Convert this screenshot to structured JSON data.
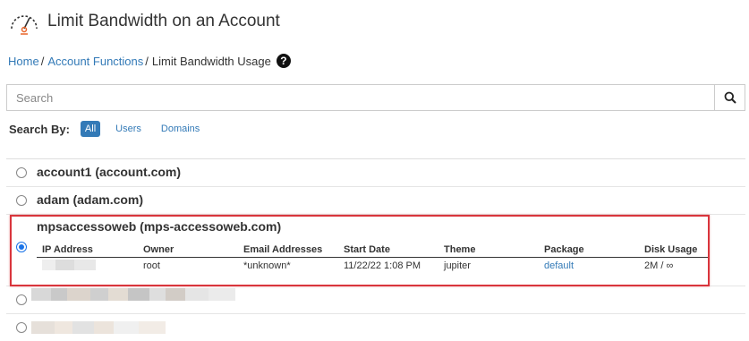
{
  "header": {
    "title": "Limit Bandwidth on an Account",
    "icon": "speedometer-icon"
  },
  "breadcrumb": {
    "items": [
      "Home",
      "Account Functions"
    ],
    "separator": "/",
    "current": "Limit Bandwidth Usage",
    "help": "?"
  },
  "search": {
    "placeholder": "Search",
    "value": ""
  },
  "search_by": {
    "label": "Search By:",
    "options": [
      "All",
      "Users",
      "Domains"
    ],
    "selected": "All"
  },
  "accounts": [
    {
      "label": "account1 (account.com)",
      "selected": false
    },
    {
      "label": "adam (adam.com)",
      "selected": false
    },
    {
      "label": "mpsaccessoweb (mps-accessoweb.com)",
      "selected": true,
      "details": {
        "headers": [
          "IP Address",
          "Owner",
          "Email Addresses",
          "Start Date",
          "Theme",
          "Package",
          "Disk Usage"
        ],
        "values": [
          "",
          "root",
          "*unknown*",
          "11/22/22 1:08 PM",
          "jupiter",
          "default",
          "2M / ∞"
        ]
      }
    }
  ],
  "colors": {
    "link": "#337ab7",
    "highlight_border": "#d9353c",
    "radio_selected": "#1a73e8"
  }
}
